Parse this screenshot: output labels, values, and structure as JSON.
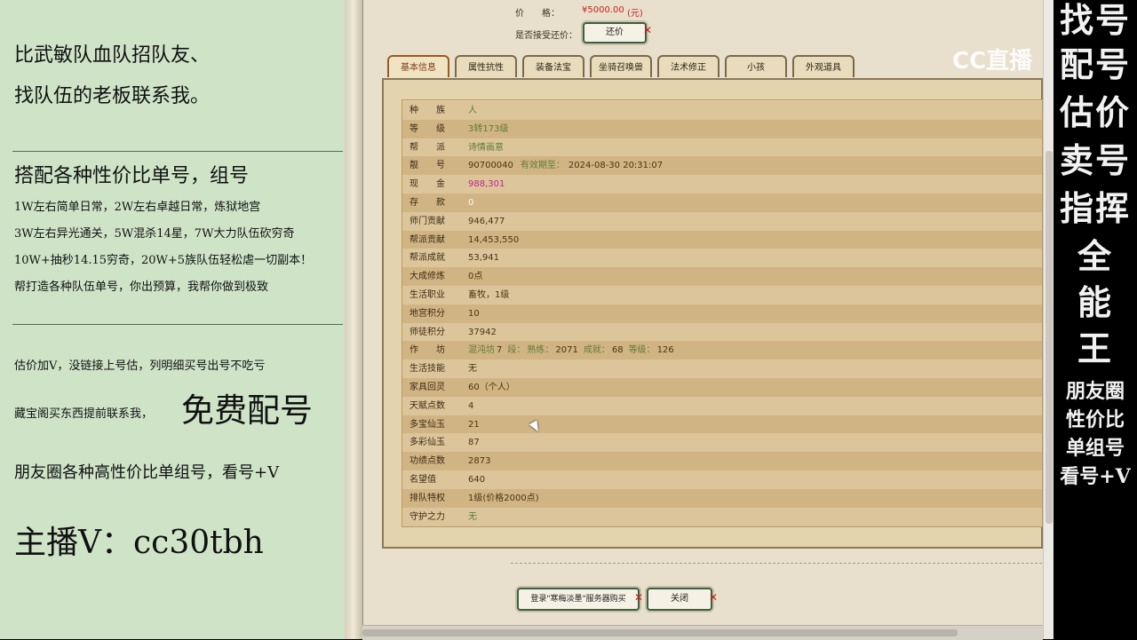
{
  "left_panel": {
    "line1": "比武敏队血队招队友、",
    "line2": "找队伍的老板联系我。",
    "heading": "搭配各种性价比单号，组号",
    "desc1": "1W左右简单日常，2W左右卓越日常，炼狱地宫",
    "desc2": "3W左右异光通关，5W混杀14星，7W大力队伍砍穷奇",
    "desc3": "10W+抽秒14.15穷奇，20W+5族队伍轻松虐一切副本！",
    "desc4": "帮打造各种队伍单号，你出预算，我帮你做到极致",
    "note1": "估价加V，没链接上号估，列明细买号出号不吃亏",
    "note2_prefix": "藏宝阁买东西提前联系我，",
    "note2_big": "免费配号",
    "note3": "朋友圈各种高性价比单组号，看号+V",
    "contact": "主播V：cc30tbh"
  },
  "top": {
    "price_label": "价　　格：",
    "price_value": "¥5000.00",
    "price_unit": "(元)",
    "bargain_label": "是否接受还价：",
    "bargain_button": "还价"
  },
  "tabs": [
    "基本信息",
    "属性抗性",
    "装备法宝",
    "坐骑召唤兽",
    "法术修正",
    "小孩",
    "外观道具"
  ],
  "rows": [
    {
      "k": "种　　族",
      "v": "人",
      "style": "green"
    },
    {
      "k": "等　　级",
      "v": "3转173级",
      "style": "green"
    },
    {
      "k": "帮　　派",
      "v": "诗情画意",
      "style": "green"
    },
    {
      "k": "靓　　号",
      "v": "90700040",
      "extra_label": "有效期至：",
      "extra_value": "2024-08-30 20:31:07",
      "style": ""
    },
    {
      "k": "现　　金",
      "v": "988,301",
      "style": "magenta"
    },
    {
      "k": "存　　款",
      "v": "0",
      "style": "white"
    },
    {
      "k": "师门贡献",
      "v": "946,477",
      "style": ""
    },
    {
      "k": "帮派贡献",
      "v": "14,453,550",
      "style": ""
    },
    {
      "k": "帮派成就",
      "v": "53,941",
      "style": ""
    },
    {
      "k": "大成修炼",
      "v": "0点",
      "style": ""
    },
    {
      "k": "生活职业",
      "v": "畜牧，1级",
      "style": ""
    },
    {
      "k": "地宫积分",
      "v": "10",
      "style": ""
    },
    {
      "k": "师徒积分",
      "v": "37942",
      "style": ""
    },
    {
      "k": "作　　坊",
      "v": "",
      "workshop": {
        "a_label": "混沌坊",
        "a_value": "7",
        "b_label": "段：",
        "c_label": "熟练：",
        "c_value": "2071",
        "d_label": "成就：",
        "d_value": "68",
        "e_label": "等级：",
        "e_value": "126"
      },
      "style": ""
    },
    {
      "k": "生活技能",
      "v": "无",
      "style": ""
    },
    {
      "k": "家具回灵",
      "v": "60（个人）",
      "style": ""
    },
    {
      "k": "天赋点数",
      "v": "4",
      "style": ""
    },
    {
      "k": "多宝仙玉",
      "v": "21",
      "style": ""
    },
    {
      "k": "多彩仙玉",
      "v": "87",
      "style": ""
    },
    {
      "k": "功绩点数",
      "v": "2873",
      "style": ""
    },
    {
      "k": "名望值",
      "v": "640",
      "style": ""
    },
    {
      "k": "排队特权",
      "v": "1级(价格2000点)",
      "style": ""
    },
    {
      "k": "守护之力",
      "v": "无",
      "style": "green"
    }
  ],
  "bottom": {
    "login_button": "登录\"寒梅淡墨\"服务器购买",
    "close_button": "关闭"
  },
  "watermark": "CC直播",
  "right_panel": {
    "big": [
      "找号",
      "配号",
      "估价",
      "卖号",
      "指挥",
      "全",
      "能",
      "王"
    ],
    "small": [
      "朋友圈",
      "性价比",
      "单组号",
      "看号+V"
    ]
  }
}
